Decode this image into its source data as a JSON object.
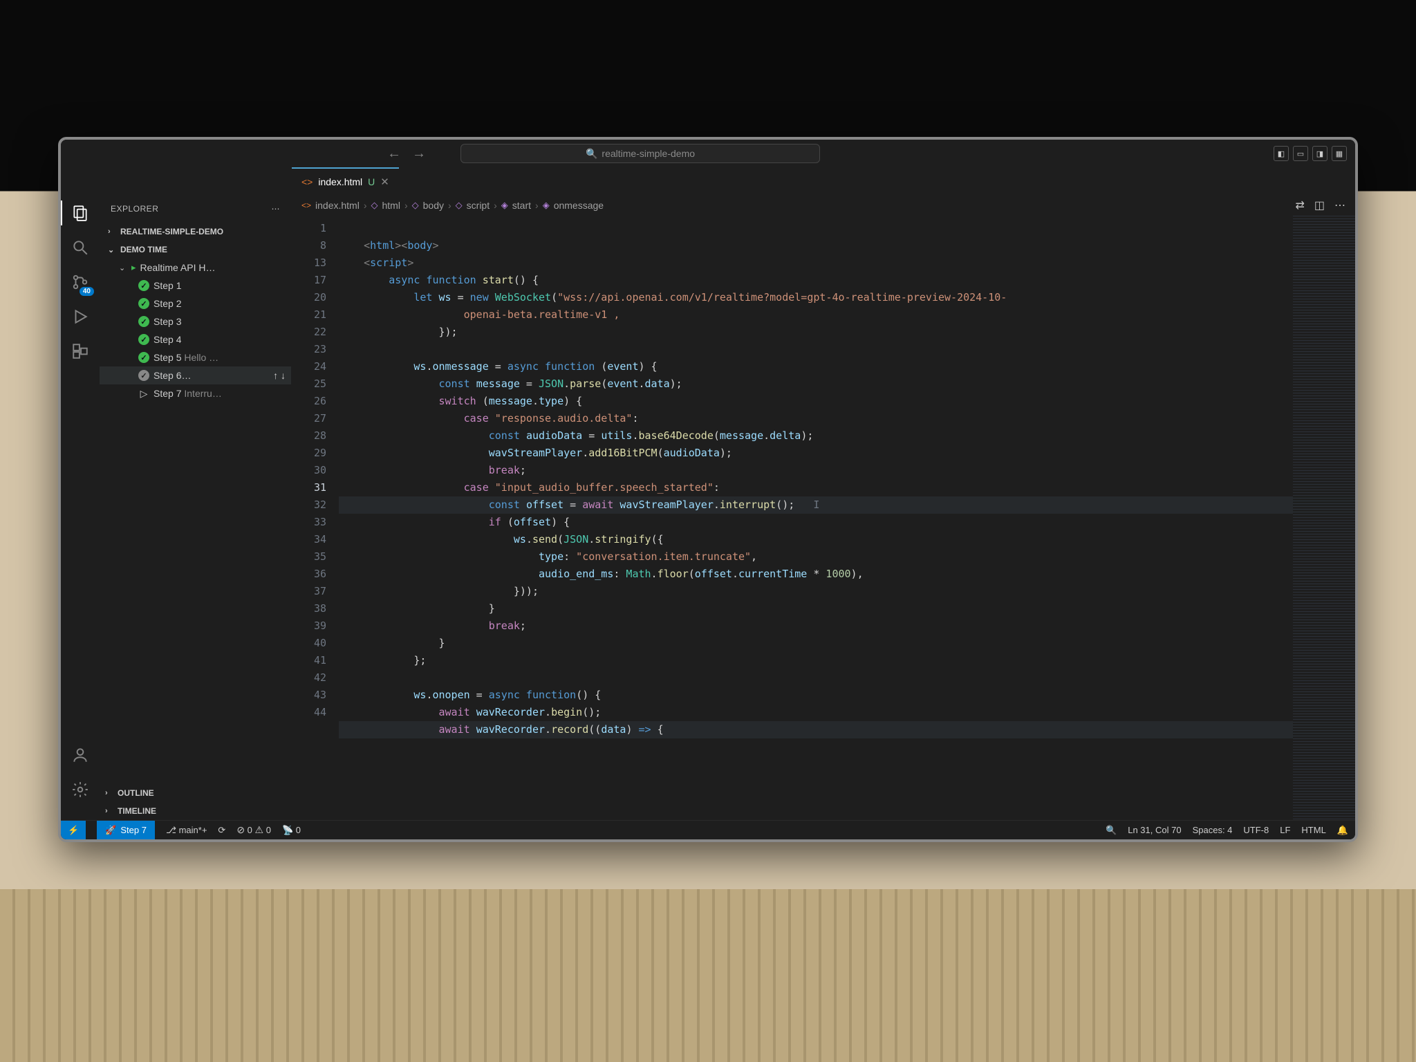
{
  "titlebar": {
    "search_label": "realtime-simple-demo"
  },
  "tab": {
    "filename": "index.html",
    "git_flag": "U"
  },
  "sidebar": {
    "title": "EXPLORER",
    "folders": [
      {
        "name": "REALTIME-SIMPLE-DEMO",
        "expanded": false
      },
      {
        "name": "DEMO TIME",
        "expanded": true
      }
    ],
    "demo_section": "Realtime API H…",
    "steps": [
      {
        "label": "Step 1",
        "state": "done"
      },
      {
        "label": "Step 2",
        "state": "done"
      },
      {
        "label": "Step 3",
        "state": "done"
      },
      {
        "label": "Step 4",
        "state": "done"
      },
      {
        "label": "Step 5",
        "suffix": "Hello …",
        "state": "done"
      },
      {
        "label": "Step 6…",
        "state": "pending",
        "selected": true
      },
      {
        "label": "Step 7",
        "suffix": "Interru…",
        "state": "todo"
      }
    ],
    "outline": "OUTLINE",
    "timeline": "TIMELINE"
  },
  "breadcrumb": {
    "file": "index.html",
    "path": [
      "html",
      "body",
      "script",
      "start",
      "onmessage"
    ]
  },
  "activity": {
    "scm_badge": "40"
  },
  "gutter_lines": [
    "1",
    "8",
    "13",
    "17",
    "20",
    "21",
    "22",
    "23",
    "24",
    "25",
    "26",
    "27",
    "28",
    "29",
    "30",
    "31",
    "32",
    "33",
    "34",
    "35",
    "36",
    "37",
    "38",
    "39",
    "40",
    "41",
    "42",
    "43",
    "44"
  ],
  "gutter_highlight": "31",
  "code": {
    "l1": {
      "pre": "    ",
      "tag_open": "<html><body>"
    },
    "l2": {
      "pre": "    ",
      "tag_open": "<script>"
    },
    "l3": {
      "pre": "        ",
      "kw1": "async function ",
      "fn": "start",
      "rest": "() {"
    },
    "l4": {
      "pre": "            ",
      "kw1": "let ",
      "v1": "ws",
      "mid": " = ",
      "kw2": "new ",
      "cls": "WebSocket",
      "p1": "(",
      "str": "\"wss://api.openai.com/v1/realtime?model=gpt-4o-realtime-preview-2024-10-"
    },
    "l4b": {
      "pre": "                    ",
      "str": "openai-beta.realtime-v1 ,"
    },
    "l5": {
      "pre": "                ",
      "rest": "});"
    },
    "l6": {
      "pre": ""
    },
    "l7": {
      "pre": "            ",
      "v1": "ws",
      "p1": ".",
      "v2": "onmessage",
      "mid": " = ",
      "kw1": "async function ",
      "rest": "(",
      "v3": "event",
      "rest2": ") {"
    },
    "l8": {
      "pre": "                ",
      "kw1": "const ",
      "v1": "message",
      "mid": " = ",
      "cls": "JSON",
      "p1": ".",
      "fn": "parse",
      "p2": "(",
      "v2": "event",
      "p3": ".",
      "v3": "data",
      "p4": ");"
    },
    "l9": {
      "pre": "                ",
      "kw1": "switch ",
      "p1": "(",
      "v1": "message",
      "p2": ".",
      "v2": "type",
      "p3": ") {"
    },
    "l10": {
      "pre": "                    ",
      "kw1": "case ",
      "str": "\"response.audio.delta\"",
      "p1": ":"
    },
    "l11": {
      "pre": "                        ",
      "kw1": "const ",
      "v1": "audioData",
      "mid": " = ",
      "v2": "utils",
      "p1": ".",
      "fn": "base64Decode",
      "p2": "(",
      "v3": "message",
      "p3": ".",
      "v4": "delta",
      "p4": ");"
    },
    "l12": {
      "pre": "                        ",
      "v1": "wavStreamPlayer",
      "p1": ".",
      "fn": "add16BitPCM",
      "p2": "(",
      "v2": "audioData",
      "p3": ");"
    },
    "l13": {
      "pre": "                        ",
      "kw1": "break",
      "p1": ";"
    },
    "l14": {
      "pre": "                    ",
      "kw1": "case ",
      "str": "\"input_audio_buffer.speech_started\"",
      "p1": ":"
    },
    "l15": {
      "pre": "                        ",
      "kw1": "const ",
      "v1": "offset",
      "mid": " = ",
      "kw2": "await ",
      "v2": "wavStreamPlayer",
      "p1": ".",
      "fn": "interrupt",
      "p2": "();   ",
      "cur": "I"
    },
    "l16": {
      "pre": "                        ",
      "kw1": "if ",
      "p1": "(",
      "v1": "offset",
      "p2": ") {"
    },
    "l17": {
      "pre": "                            ",
      "v1": "ws",
      "p1": ".",
      "fn": "send",
      "p2": "(",
      "cls": "JSON",
      "p3": ".",
      "fn2": "stringify",
      "p4": "({"
    },
    "l18": {
      "pre": "                                ",
      "v1": "type",
      "p1": ": ",
      "str": "\"conversation.item.truncate\"",
      "p2": ","
    },
    "l19": {
      "pre": "                                ",
      "v1": "audio_end_ms",
      "p1": ": ",
      "cls": "Math",
      "p2": ".",
      "fn": "floor",
      "p3": "(",
      "v2": "offset",
      "p4": ".",
      "v3": "currentTime",
      "p5": " * ",
      "num": "1000",
      "p6": "),"
    },
    "l20": {
      "pre": "                            ",
      "rest": "}));"
    },
    "l21": {
      "pre": "                        ",
      "rest": "}"
    },
    "l22": {
      "pre": "                        ",
      "kw1": "break",
      "p1": ";"
    },
    "l23": {
      "pre": "                ",
      "rest": "}"
    },
    "l24": {
      "pre": "            ",
      "rest": "};"
    },
    "l25": {
      "pre": ""
    },
    "l26": {
      "pre": "            ",
      "v1": "ws",
      "p1": ".",
      "v2": "onopen",
      "mid": " = ",
      "kw1": "async function",
      "rest": "() {"
    },
    "l27": {
      "pre": "                ",
      "kw1": "await ",
      "v1": "wavRecorder",
      "p1": ".",
      "fn": "begin",
      "p2": "();"
    },
    "l28": {
      "pre": "                ",
      "kw1": "await ",
      "v1": "wavRecorder",
      "p1": ".",
      "fn": "record",
      "p2": "((",
      "v2": "data",
      "p3": ") ",
      "kw2": "=>",
      "p4": " {"
    }
  },
  "status": {
    "step": "Step 7",
    "branch": "main*+",
    "sync": "⟳",
    "errors": "0",
    "warnings": "0",
    "port": "0",
    "cursor": "Ln 31, Col 70",
    "spaces": "Spaces: 4",
    "encoding": "UTF-8",
    "eol": "LF",
    "lang": "HTML"
  }
}
